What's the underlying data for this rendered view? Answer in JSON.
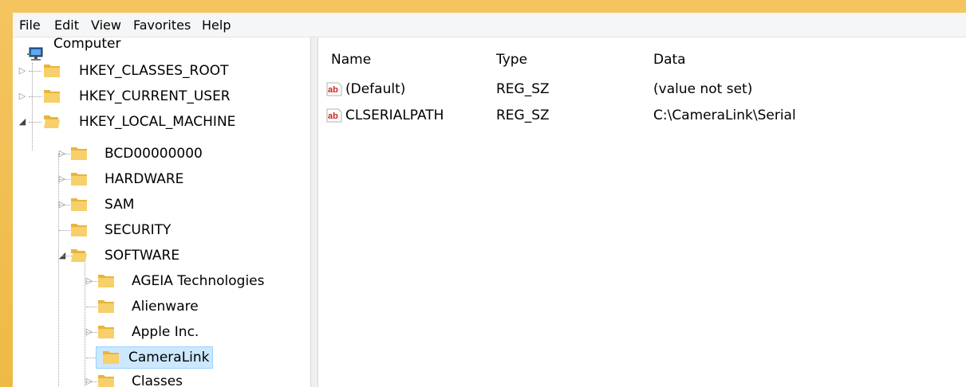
{
  "menu": [
    "File",
    "Edit",
    "View",
    "Favorites",
    "Help"
  ],
  "tree": {
    "root": "Computer",
    "hives": [
      {
        "label": "HKEY_CLASSES_ROOT",
        "expander": "collapsed"
      },
      {
        "label": "HKEY_CURRENT_USER",
        "expander": "collapsed"
      },
      {
        "label": "HKEY_LOCAL_MACHINE",
        "expander": "expanded"
      }
    ],
    "hklm_children": [
      {
        "label": "BCD00000000",
        "expander": "collapsed"
      },
      {
        "label": "HARDWARE",
        "expander": "collapsed"
      },
      {
        "label": "SAM",
        "expander": "collapsed"
      },
      {
        "label": "SECURITY",
        "expander": "none"
      },
      {
        "label": "SOFTWARE",
        "expander": "expanded"
      }
    ],
    "software_children": [
      {
        "label": "AGEIA Technologies",
        "expander": "collapsed"
      },
      {
        "label": "Alienware",
        "expander": "none"
      },
      {
        "label": "Apple Inc.",
        "expander": "collapsed"
      },
      {
        "label": "CameraLink",
        "expander": "none",
        "selected": true
      },
      {
        "label": "Classes",
        "expander": "collapsed"
      }
    ]
  },
  "columns": {
    "name": "Name",
    "type": "Type",
    "data": "Data"
  },
  "values": [
    {
      "name": "(Default)",
      "type": "REG_SZ",
      "data": "(value not set)",
      "icon": "string-value-icon"
    },
    {
      "name": "CLSERIALPATH",
      "type": "REG_SZ",
      "data": "C:\\CameraLink\\Serial",
      "icon": "string-value-icon"
    }
  ],
  "colors": {
    "frame": "#f4c25f",
    "selection": "#cce8ff",
    "selection_border": "#99d1ff",
    "folder": "#e8b53b"
  }
}
